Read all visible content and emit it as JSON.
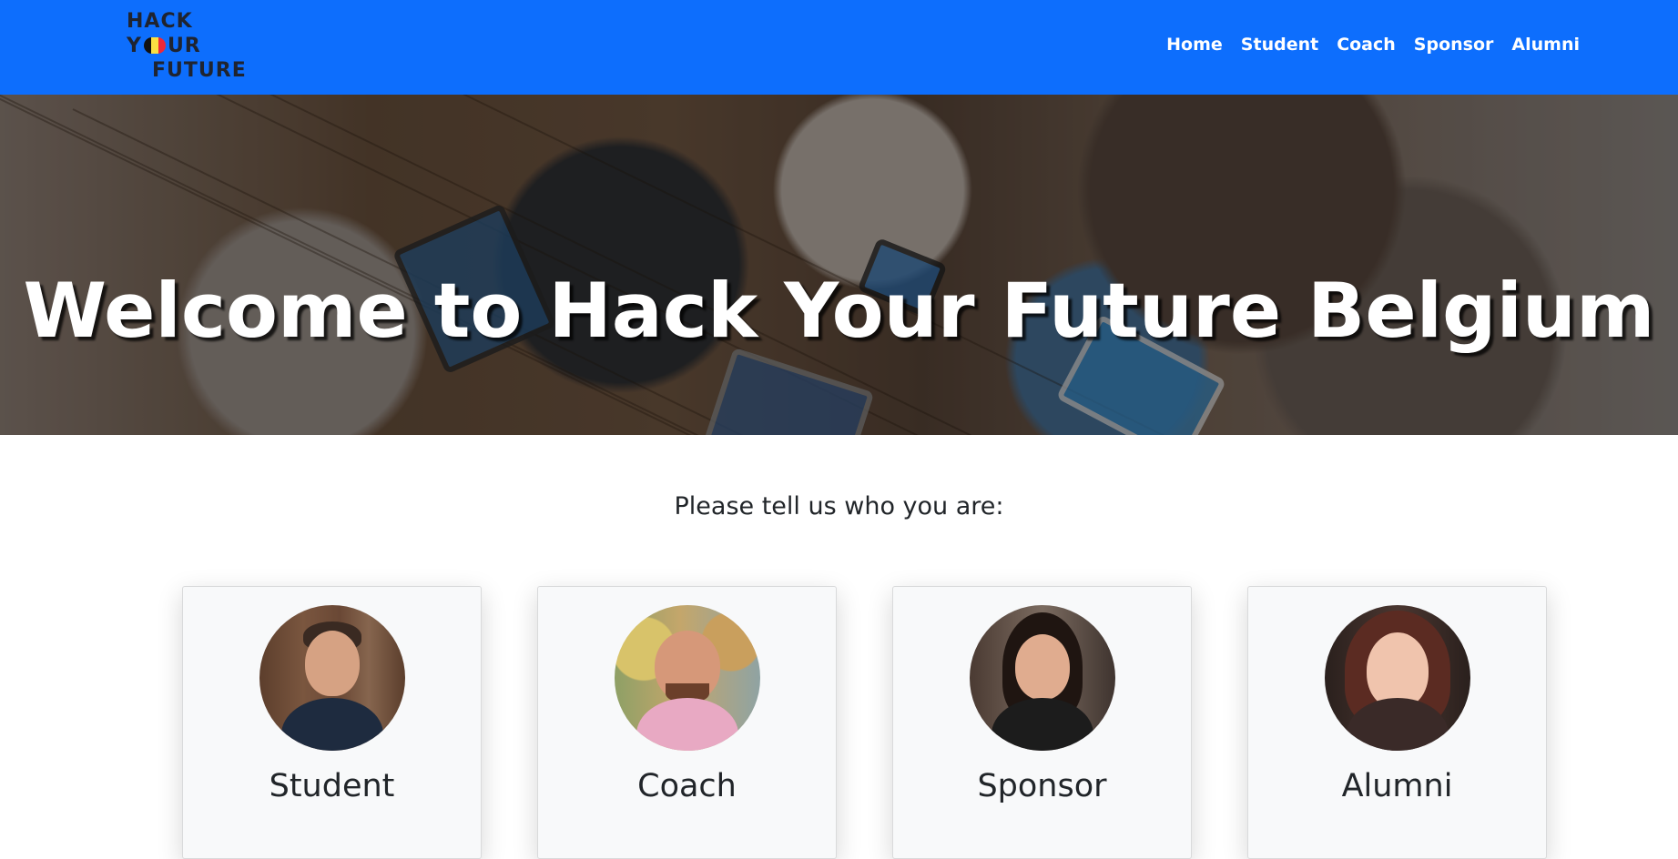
{
  "navbar": {
    "logo": {
      "line1": "HACK",
      "line2_left": "Y",
      "line2_right": "UR",
      "line3": "FUTURE"
    },
    "links": [
      "Home",
      "Student",
      "Coach",
      "Sponsor",
      "Alumni"
    ],
    "color": "#0d6efd"
  },
  "hero": {
    "title": "Welcome to Hack Your Future Belgium"
  },
  "roles": {
    "prompt": "Please tell us who you are:",
    "cards": [
      {
        "title": "Student",
        "avatar": "student-photo"
      },
      {
        "title": "Coach",
        "avatar": "coach-photo"
      },
      {
        "title": "Sponsor",
        "avatar": "sponsor-photo"
      },
      {
        "title": "Alumni",
        "avatar": "alumni-photo"
      }
    ]
  }
}
